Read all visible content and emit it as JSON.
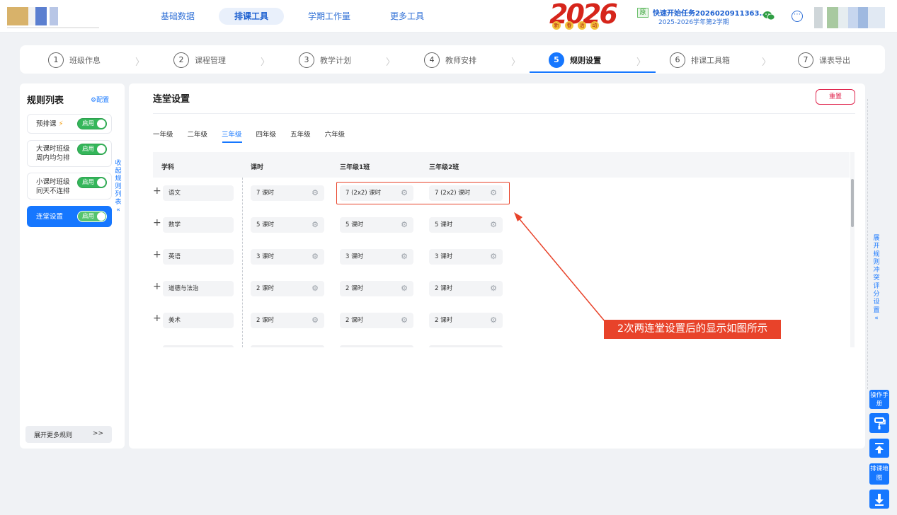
{
  "header": {
    "nav": [
      "基础数据",
      "排课工具",
      "学期工作量",
      "更多工具"
    ],
    "logo_text": "2026",
    "logo_tags": [
      "新",
      "春",
      "活",
      "动"
    ],
    "task_badge": "原",
    "task_title": "快速开始任务2026020911363...",
    "task_term": "2025-2026学年第2学期"
  },
  "steps": [
    {
      "num": "1",
      "label": "班级作息"
    },
    {
      "num": "2",
      "label": "课程管理"
    },
    {
      "num": "3",
      "label": "教学计划"
    },
    {
      "num": "4",
      "label": "教师安排"
    },
    {
      "num": "5",
      "label": "规则设置"
    },
    {
      "num": "6",
      "label": "排课工具箱"
    },
    {
      "num": "7",
      "label": "课表导出"
    }
  ],
  "left_panel": {
    "title": "规则列表",
    "config": "⚙配置",
    "rules": [
      {
        "name": "预排课",
        "toggle": "启用"
      },
      {
        "name": "大课时班级",
        "name2": "周内均匀排",
        "toggle": "启用"
      },
      {
        "name": "小课时班级",
        "name2": "同天不连排",
        "toggle": "启用"
      },
      {
        "name": "连堂设置",
        "toggle": "启用"
      }
    ],
    "collapse_text": "收起规则列表",
    "collapse_chevron": "«",
    "more_rules": "展开更多规则",
    "more_arrow": ">>"
  },
  "main": {
    "title": "连堂设置",
    "reset": "重置",
    "grades": [
      "一年级",
      "二年级",
      "三年级",
      "四年级",
      "五年级",
      "六年级"
    ],
    "columns": [
      "学科",
      "课时",
      "三年级1班",
      "三年级2班"
    ],
    "rows": [
      {
        "subject": "语文",
        "hours": "7 课时",
        "c1": "7 (2x2) 课时",
        "c2": "7 (2x2) 课时"
      },
      {
        "subject": "数学",
        "hours": "5 课时",
        "c1": "5 课时",
        "c2": "5 课时"
      },
      {
        "subject": "英语",
        "hours": "3 课时",
        "c1": "3 课时",
        "c2": "3 课时"
      },
      {
        "subject": "道德与法治",
        "hours": "2 课时",
        "c1": "2 课时",
        "c2": "2 课时"
      },
      {
        "subject": "美术",
        "hours": "2 课时",
        "c1": "2 课时",
        "c2": "2 课时"
      }
    ]
  },
  "annotation": "2次两连堂设置后的显示如图所示",
  "right_side": {
    "expand_text": "展开规则冲突评分设置",
    "expand_chevron": "«",
    "manual": "操作手册",
    "paint_icon": "paint-roller-icon",
    "top_icon": "back-to-top-icon",
    "map": "排课地图",
    "download_icon": "download-icon"
  },
  "colors": {
    "primary": "#1677ff",
    "toggle_on": "#34b65a",
    "annotation": "#e8432a",
    "reset": "#e0274f"
  }
}
